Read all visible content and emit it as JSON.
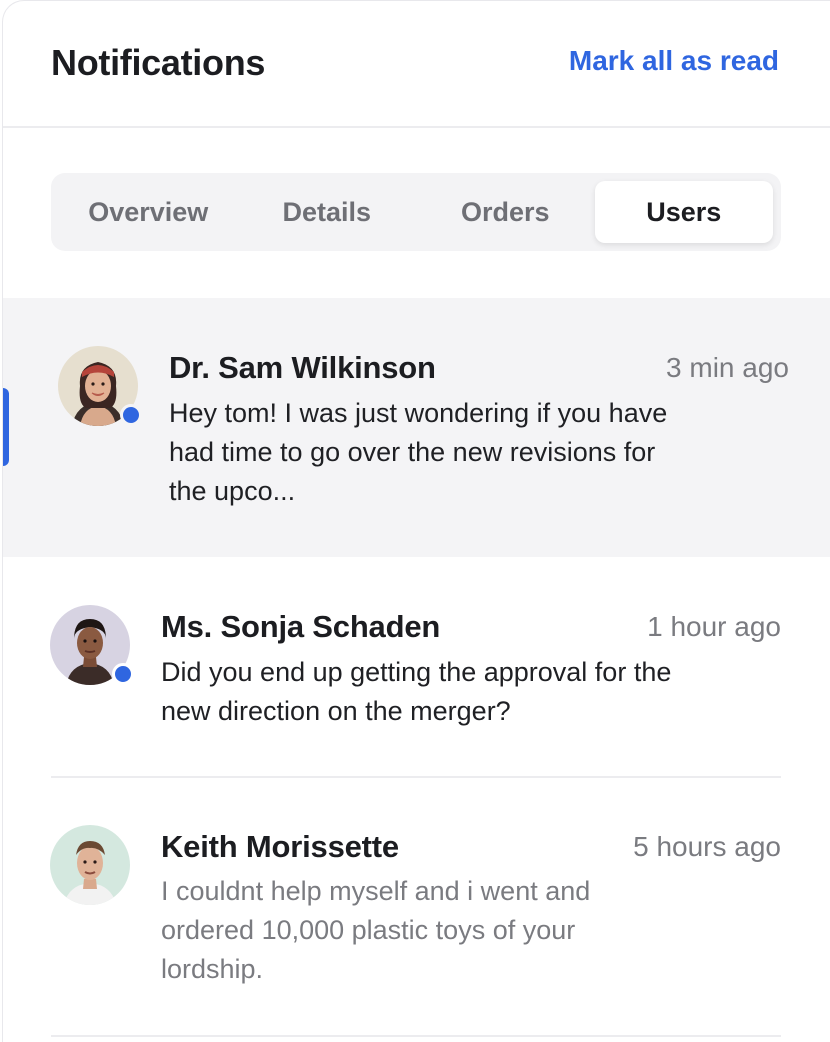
{
  "header": {
    "title": "Notifications",
    "mark_all_label": "Mark all as read"
  },
  "tabs": [
    {
      "label": "Overview",
      "active": false
    },
    {
      "label": "Details",
      "active": false
    },
    {
      "label": "Orders",
      "active": false
    },
    {
      "label": "Users",
      "active": true
    }
  ],
  "notifications": [
    {
      "name": "Dr. Sam Wilkinson",
      "time": "3 min ago",
      "message": "Hey tom! I was just wondering if you have had time to go over the new revisions for the upco...",
      "unread": true,
      "selected": true
    },
    {
      "name": "Ms. Sonja Schaden",
      "time": "1 hour ago",
      "message": "Did you end up getting the approval for the new direction on the merger?",
      "unread": true,
      "selected": false
    },
    {
      "name": "Keith Morissette",
      "time": "5 hours ago",
      "message": "I couldnt help myself and i went and ordered 10,000 plastic toys of your lordship.",
      "unread": false,
      "selected": false
    }
  ],
  "colors": {
    "accent": "#2f66e0",
    "highlight_bg": "#f4f4f6",
    "muted_text": "#7a7b80"
  }
}
